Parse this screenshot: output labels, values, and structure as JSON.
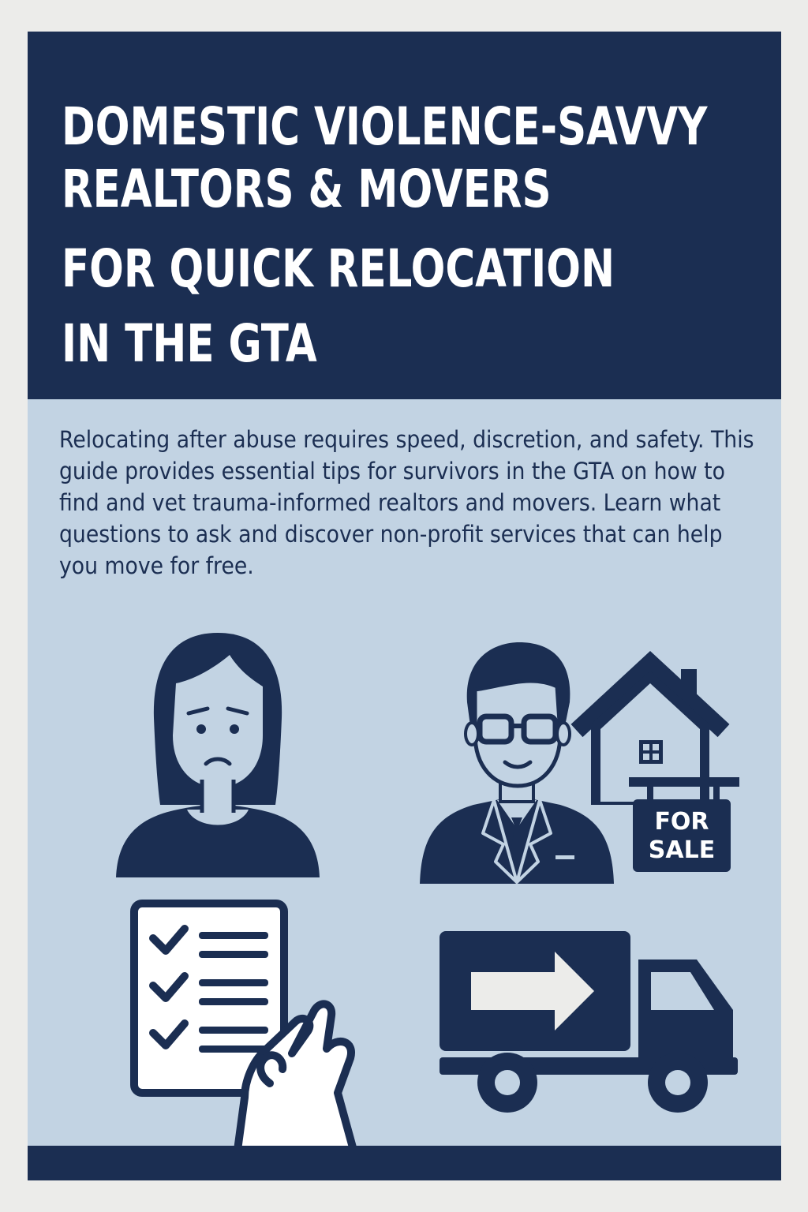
{
  "header": {
    "title_lines": [
      "DOMESTIC VIOLENCE-SAVVY",
      "REALTORS & MOVERS",
      "FOR QUICK RELOCATION",
      "IN THE GTA"
    ]
  },
  "intro": {
    "text": "Relocating after abuse requires speed, discretion, and safety. This guide provides essential tips for survivors in the GTA on how to find and vet trauma-informed realtors and movers. Learn what questions to ask and discover non-profit services that can help you move for free."
  },
  "realtor_sign": {
    "line1": "FOR",
    "line2": "SALE"
  },
  "icons": [
    "survivor-woman-icon",
    "realtor-man-icon",
    "house-icon",
    "for-sale-sign-icon",
    "checklist-icon",
    "moving-truck-icon"
  ],
  "colors": {
    "navy": "#1b2e52",
    "light_blue": "#c2d3e3",
    "white": "#ffffff",
    "page": "#ececea"
  }
}
